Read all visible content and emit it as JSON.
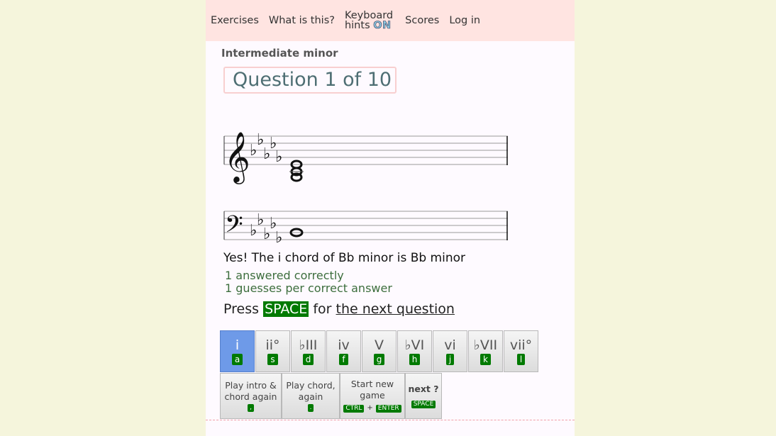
{
  "nav": {
    "exercises": "Exercises",
    "what_is_this": "What is this?",
    "keyboard_hints_line1": "Keyboard",
    "keyboard_hints_line2": "hints",
    "keyboard_hints_state": "ON",
    "scores": "Scores",
    "login": "Log in"
  },
  "exercise_name": "Intermediate minor",
  "question_counter": "Question 1 of 10",
  "feedback": "Yes! The i chord of Bb minor is Bb minor",
  "stats": {
    "correct": "1 answered correctly",
    "guesses": "1 guesses per correct answer"
  },
  "press": {
    "prefix": "Press",
    "key": "SPACE",
    "middle": "for",
    "link": "the next question"
  },
  "chord_buttons": [
    {
      "label": "i",
      "key": "a",
      "selected": true
    },
    {
      "label": "ii°",
      "key": "s"
    },
    {
      "label": "♭III",
      "key": "d"
    },
    {
      "label": "iv",
      "key": "f"
    },
    {
      "label": "V",
      "key": "g"
    },
    {
      "label": "♭VI",
      "key": "h"
    },
    {
      "label": "vi",
      "key": "j"
    },
    {
      "label": "♭VII",
      "key": "k"
    },
    {
      "label": "vii°",
      "key": "l"
    }
  ],
  "actions": {
    "play_intro": {
      "line1": "Play intro &",
      "line2": "chord again",
      "key": ","
    },
    "play_chord": {
      "line1": "Play chord,",
      "line2": "again",
      "key": "."
    },
    "new_game": {
      "line1": "Start new",
      "line2": "game",
      "key1": "CTRL",
      "plus": "+",
      "key2": "ENTER"
    },
    "next": {
      "label": "next ?",
      "key": "SPACE"
    }
  },
  "colors": {
    "nav_bg": "#ffe4e1",
    "key_green": "#007a00",
    "selected_blue": "#6e9ae8"
  }
}
